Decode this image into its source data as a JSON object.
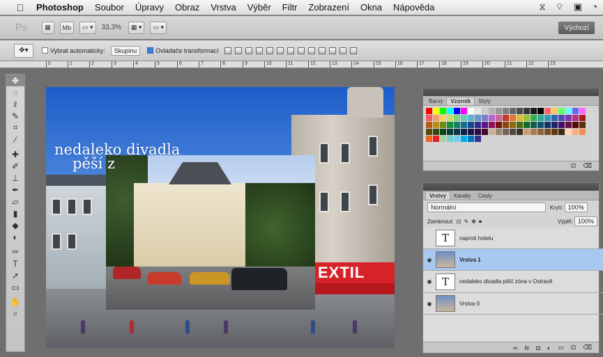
{
  "menubar": {
    "app_name": "Photoshop",
    "menus": [
      "Soubor",
      "Úpravy",
      "Obraz",
      "Vrstva",
      "Výběr",
      "Filtr",
      "Zobrazení",
      "Okna",
      "Nápověda"
    ],
    "right_icons": [
      "adobe-icon",
      "wifi-icon",
      "screen-icon",
      "time-machine-icon"
    ]
  },
  "appbar": {
    "logo": "Ps",
    "zoom": "33,3%",
    "workspace": "Výchozí"
  },
  "options": {
    "auto_select_label": "Vybrat automaticky:",
    "auto_select_value": "Skupinu",
    "transform_label": "Ovladače transformací"
  },
  "ruler": [
    "0",
    "1",
    "2",
    "3",
    "4",
    "5",
    "6",
    "7",
    "8",
    "9",
    "10",
    "11",
    "12",
    "13",
    "14",
    "15",
    "16",
    "17",
    "18",
    "19",
    "20",
    "21",
    "22",
    "23"
  ],
  "canvas": {
    "headline_1": "nedaleko divadla",
    "headline_2": "pěší z",
    "sign_text": "EXTIL"
  },
  "swatches_panel": {
    "tabs": [
      "Barvy",
      "Vzorník",
      "Styly"
    ],
    "active_tab": "Vzorník",
    "colors": [
      "#ff0000",
      "#ffff00",
      "#00ff00",
      "#00ffff",
      "#0000ff",
      "#ff00ff",
      "#ffffff",
      "#e6e6e6",
      "#cccccc",
      "#b3b3b3",
      "#999999",
      "#808080",
      "#666666",
      "#4d4d4d",
      "#333333",
      "#1a1a1a",
      "#000000",
      "#ff6666",
      "#ffcc66",
      "#66ff66",
      "#66ffff",
      "#6666ff",
      "#ff66ff",
      "#f25c5c",
      "#f5a06a",
      "#f7d16b",
      "#c7e06b",
      "#7fd67f",
      "#66ccb3",
      "#66b3cc",
      "#6699cc",
      "#7f7fcc",
      "#b366cc",
      "#cc6699",
      "#cc3333",
      "#e07a33",
      "#e0b833",
      "#99c233",
      "#33b34d",
      "#33a699",
      "#3399b3",
      "#3366b3",
      "#4d4db3",
      "#8033b3",
      "#b3337a",
      "#a61c1c",
      "#b85c14",
      "#b88f14",
      "#6b8f14",
      "#148f33",
      "#148070",
      "#14708f",
      "#14478f",
      "#2e2e8f",
      "#5c148f",
      "#8f145c",
      "#7a1010",
      "#8a4510",
      "#8a6b10",
      "#4f6b10",
      "#106b26",
      "#105e52",
      "#10526b",
      "#10346b",
      "#22226b",
      "#45106b",
      "#6b1045",
      "#520a0a",
      "#5c2e0a",
      "#5c470a",
      "#35470a",
      "#0a4719",
      "#0a3e36",
      "#0a3647",
      "#0a2347",
      "#161647",
      "#2e0a47",
      "#470a2e",
      "#c7b299",
      "#998675",
      "#736357",
      "#534741",
      "#37302a",
      "#c69c6d",
      "#a67c52",
      "#8c6239",
      "#754c24",
      "#603913",
      "#3c2415",
      "#ffd5b5",
      "#f9ad81",
      "#f68e56",
      "#f26522",
      "#ed1c24",
      "#a3d39c",
      "#7accc8",
      "#6dcff6",
      "#00aeef",
      "#0072bc",
      "#2e3192"
    ],
    "footer_icons": [
      "new-swatch-icon",
      "trash-icon"
    ]
  },
  "layers_panel": {
    "tabs": [
      "Vrstvy",
      "Kanály",
      "Cesty"
    ],
    "active_tab": "Vrstvy",
    "blend_mode": "Normální",
    "opacity_label": "Krytí:",
    "opacity_value": "100%",
    "lock_label": "Zamknout:",
    "fill_label": "Výplň:",
    "fill_value": "100%",
    "layers": [
      {
        "name": "naproti hotelu",
        "type": "text",
        "visible": false,
        "selected": false
      },
      {
        "name": "Vrstva 1",
        "type": "image",
        "visible": true,
        "selected": true
      },
      {
        "name": "nedaleko divadla   pěší zóna v Ostravě",
        "type": "text",
        "visible": true,
        "selected": false
      },
      {
        "name": "Vrstva 0",
        "type": "image",
        "visible": true,
        "selected": false
      }
    ],
    "footer_icons": [
      "link-icon",
      "fx-icon",
      "mask-icon",
      "adjustment-icon",
      "group-icon",
      "new-layer-icon",
      "trash-icon"
    ]
  },
  "tools": [
    "move-tool",
    "marquee-tool",
    "lasso-tool",
    "quick-select-tool",
    "crop-tool",
    "eyedropper-tool",
    "healing-tool",
    "brush-tool",
    "clone-stamp-tool",
    "history-brush-tool",
    "eraser-tool",
    "gradient-tool",
    "blur-tool",
    "dodge-tool",
    "pen-tool",
    "type-tool",
    "path-select-tool",
    "shape-tool",
    "hand-tool",
    "zoom-tool"
  ]
}
